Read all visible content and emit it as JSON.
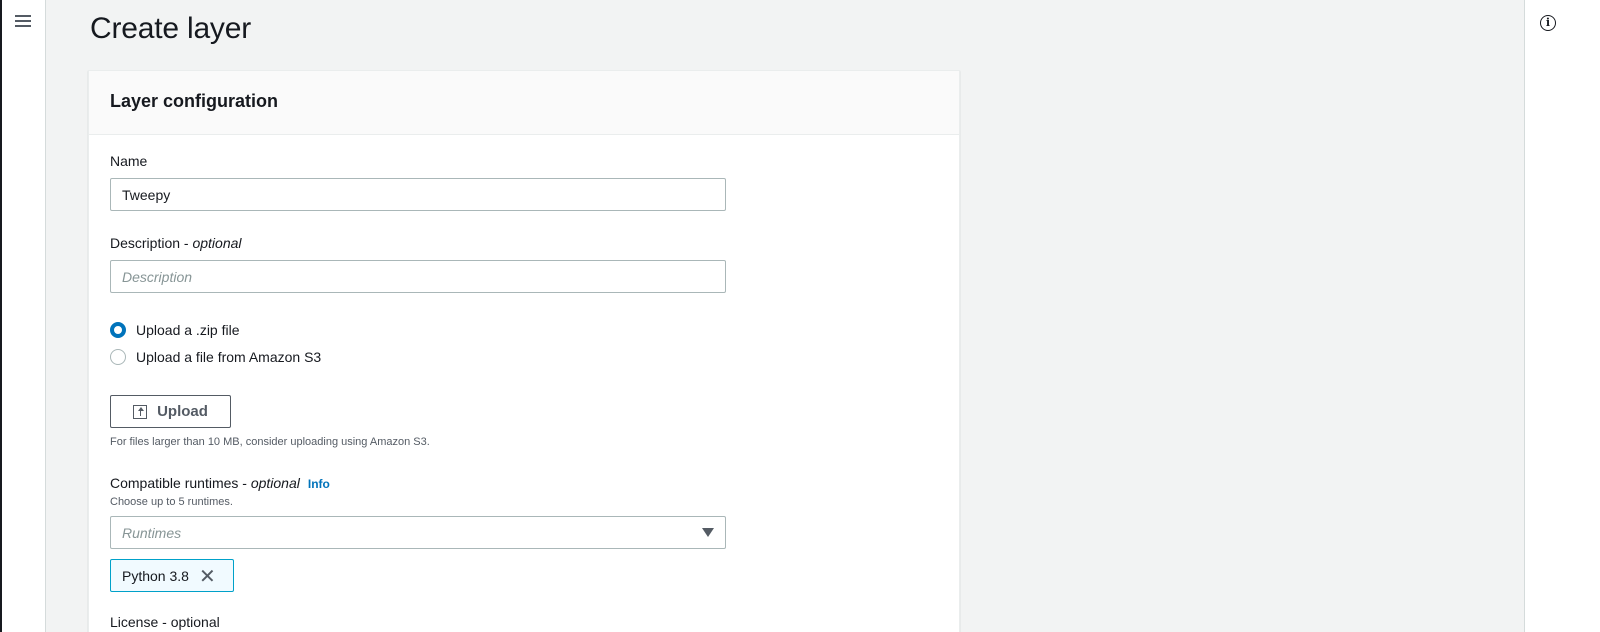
{
  "page": {
    "title": "Create layer"
  },
  "icons": {
    "menu": "hamburger-menu-icon",
    "info": "info-circle-icon",
    "upload": "upload-icon",
    "remove": "close-icon",
    "dropdown": "caret-down-icon"
  },
  "panel": {
    "title": "Layer configuration",
    "name": {
      "label": "Name",
      "value": "Tweepy"
    },
    "description": {
      "label": "Description - ",
      "optional": "optional",
      "placeholder": "Description",
      "value": ""
    },
    "upload_options": [
      {
        "label": "Upload a .zip file",
        "selected": true
      },
      {
        "label": "Upload a file from Amazon S3",
        "selected": false
      }
    ],
    "upload_button": "Upload",
    "upload_hint": "For files larger than 10 MB, consider uploading using Amazon S3.",
    "runtimes": {
      "label": "Compatible runtimes - ",
      "optional": "optional",
      "info": "Info",
      "hint": "Choose up to 5 runtimes.",
      "placeholder": "Runtimes",
      "selected": [
        "Python 3.8"
      ]
    },
    "next_label_partial": "License - optional"
  },
  "colors": {
    "accent": "#0073bb",
    "token_border": "#00a1c9",
    "token_bg": "#f1faff",
    "page_bg": "#f2f3f3",
    "text": "#16191f"
  }
}
